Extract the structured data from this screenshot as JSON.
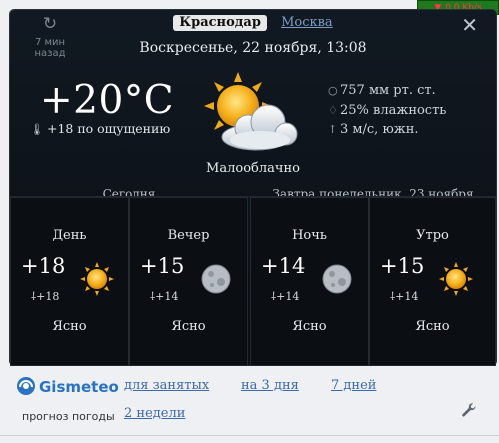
{
  "system": {
    "network_speed": "0,0 Kb/s",
    "network_indicator": "down-arrow-icon"
  },
  "header": {
    "refresh_icon": "refresh-icon",
    "updated": "7 мин назад",
    "active_city": "Краснодар",
    "other_city": "Москва",
    "datetime": "Воскресенье, 22 ноября, 13:08"
  },
  "current": {
    "temperature": "+20°C",
    "feels_like": "+18 по ощущению",
    "condition": "Малооблачно",
    "icon": "partly-cloudy-icon",
    "pressure": "757 мм рт. ст.",
    "humidity": "25% влажность",
    "wind": "3 м/с, южн."
  },
  "sections": {
    "today": "Сегодня",
    "tomorrow": "Завтра понедельник, 23 ноября"
  },
  "forecast": [
    {
      "period": "День",
      "temp": "+18",
      "feels": "+18",
      "state": "Ясно",
      "icon": "sun-icon"
    },
    {
      "period": "Вечер",
      "temp": "+15",
      "feels": "+14",
      "state": "Ясно",
      "icon": "moon-icon"
    },
    {
      "period": "Ночь",
      "temp": "+14",
      "feels": "+14",
      "state": "Ясно",
      "icon": "moon-icon"
    },
    {
      "period": "Утро",
      "temp": "+15",
      "feels": "+14",
      "state": "Ясно",
      "icon": "sun-icon"
    }
  ],
  "footer": {
    "logo_text": "Gismeteo",
    "subtitle": "прогноз погоды",
    "links": [
      "для занятых",
      "на 3 дня",
      "7 дней",
      "2 недели"
    ],
    "settings_icon": "wrench-icon"
  },
  "colors": {
    "panel": "#0e141b",
    "link": "#3b6aa8",
    "city_link": "#7b9cc4",
    "sun": "#f2a51a"
  }
}
